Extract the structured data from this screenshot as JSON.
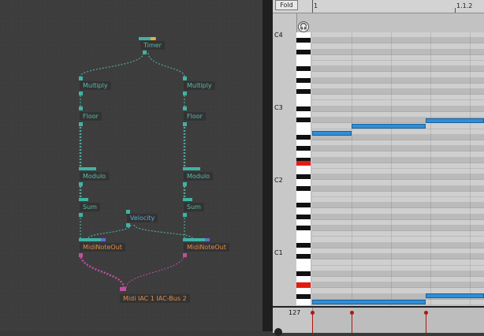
{
  "graph": {
    "nodes": {
      "timer": "Timer",
      "multiply_l": "Multiply",
      "multiply_r": "Multiply",
      "floor_l": "Floor",
      "floor_r": "Floor",
      "modulo_l": "Modulo",
      "modulo_r": "Modulo",
      "sum_l": "Sum",
      "sum_r": "Sum",
      "velocity": "Velocity",
      "midiout_l": "MidiNoteOut",
      "midiout_r": "MidiNoteOut",
      "midi_device": "Midi IAC 1 IAC-Bus 2"
    },
    "colors": {
      "node_text": "#59b9ad",
      "out_text": "#e28c4a",
      "velocity_text": "#5ba6d9",
      "port_teal": "#3fb3a4",
      "port_pink": "#c050a0",
      "port_yellow": "#e0b040",
      "port_purple": "#6a6ad8"
    }
  },
  "piano_roll": {
    "fold_label": "Fold",
    "ruler": {
      "start": "1",
      "end": "1.1.2"
    },
    "octaves": [
      "C4",
      "C3",
      "C2",
      "C1"
    ],
    "velocity_max": "127",
    "headphones_icon": "headphones-icon",
    "note_color": "#2f8ed7",
    "active_key_color": "#e51b12"
  }
}
